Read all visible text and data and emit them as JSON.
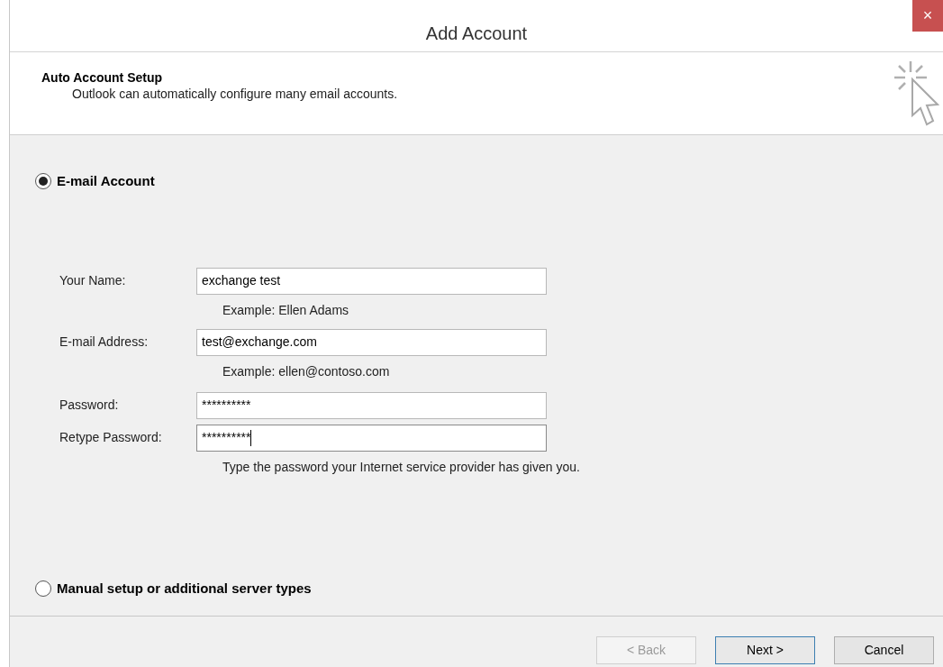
{
  "window": {
    "title": "Add Account",
    "close": "×"
  },
  "header": {
    "title": "Auto Account Setup",
    "subtitle": "Outlook can automatically configure many email accounts."
  },
  "options": [
    {
      "label": "E-mail Account",
      "selected": true
    },
    {
      "label": "Manual setup or additional server types",
      "selected": false
    }
  ],
  "fields": [
    {
      "label": "Your Name:",
      "value": "exchange test",
      "hint": "Example: Ellen Adams",
      "focused": false
    },
    {
      "label": "E-mail Address:",
      "value": "test@exchange.com",
      "hint": "Example: ellen@contoso.com",
      "focused": false
    },
    {
      "label": "Password:",
      "value": "**********",
      "focused": false
    },
    {
      "label": "Retype Password:",
      "value": "**********",
      "hint": "Type the password your Internet service provider has given you.",
      "focused": true
    }
  ],
  "buttons": [
    {
      "label": "< Back",
      "disabled": true,
      "default": false
    },
    {
      "label": "Next >",
      "disabled": false,
      "default": true
    },
    {
      "label": "Cancel",
      "disabled": false,
      "default": false
    }
  ]
}
